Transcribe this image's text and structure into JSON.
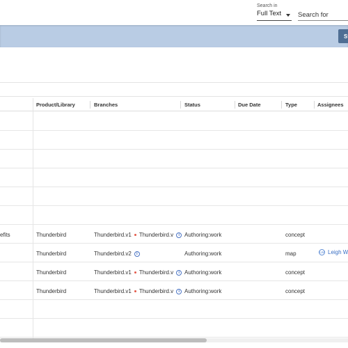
{
  "search": {
    "in_label": "Search in",
    "in_value": "Full Text",
    "for_placeholder": "Search for"
  },
  "toolbar": {
    "action_label": "St"
  },
  "table": {
    "headers": [
      "Product/Library",
      "Branches",
      "Status",
      "Due Date",
      "Type",
      "Assignees"
    ],
    "rows": [
      {
        "title_tail": "efits",
        "product": "Thunderbird",
        "branch1": "Thunderbird.v1",
        "branch2": "Thunderbird.v",
        "status": "Authoring:work",
        "due": "",
        "type": "concept",
        "assignee": ""
      },
      {
        "title_tail": "",
        "product": "Thunderbird",
        "branch1": "Thunderbird.v2",
        "branch2": "",
        "status": "Authoring:work",
        "due": "",
        "type": "map",
        "assignee_initials": "LW",
        "assignee": "Leigh Wi"
      },
      {
        "title_tail": "",
        "product": "Thunderbird",
        "branch1": "Thunderbird.v1",
        "branch2": "Thunderbird.v",
        "status": "Authoring:work",
        "due": "",
        "type": "concept",
        "assignee": ""
      },
      {
        "title_tail": "",
        "product": "Thunderbird",
        "branch1": "Thunderbird.v1",
        "branch2": "Thunderbird.v",
        "status": "Authoring:work",
        "due": "",
        "type": "concept",
        "assignee": ""
      }
    ]
  },
  "icons": {
    "info": "info-icon",
    "caret": "caret-down-icon",
    "avatar": "user-avatar-icon"
  },
  "colors": {
    "toolbar_bg": "#b9cce4",
    "action_btn": "#4f6e94",
    "link": "#3a6fc4",
    "dot": "#e45a4a"
  }
}
